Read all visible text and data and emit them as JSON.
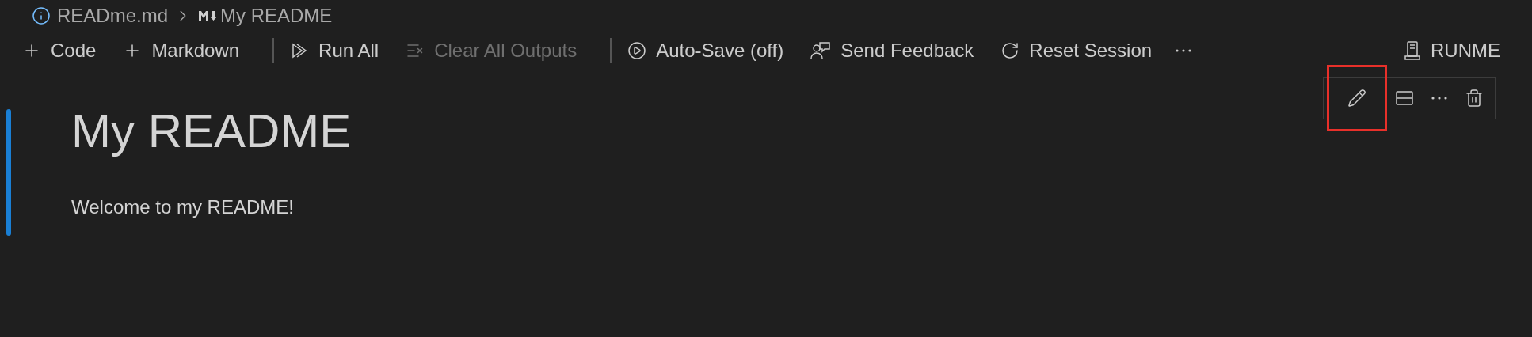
{
  "breadcrumb": {
    "file": "READme.md",
    "section": "My README"
  },
  "toolbar": {
    "items": [
      {
        "label": "Code",
        "disabled": false
      },
      {
        "label": "Markdown",
        "disabled": false
      },
      {
        "label": "Run All",
        "disabled": false
      },
      {
        "label": "Clear All Outputs",
        "disabled": true
      },
      {
        "label": "Auto-Save (off)",
        "disabled": false
      },
      {
        "label": "Send Feedback",
        "disabled": false
      },
      {
        "label": "Reset Session",
        "disabled": false
      }
    ],
    "kernel": "RUNME"
  },
  "cell_toolbar": {
    "actions": [
      {
        "highlighted": true
      },
      {
        "highlighted": false
      },
      {
        "highlighted": false
      },
      {
        "highlighted": false
      }
    ]
  },
  "cell": {
    "selected": true,
    "heading": "My README",
    "paragraph": "Welcome to my README!"
  }
}
